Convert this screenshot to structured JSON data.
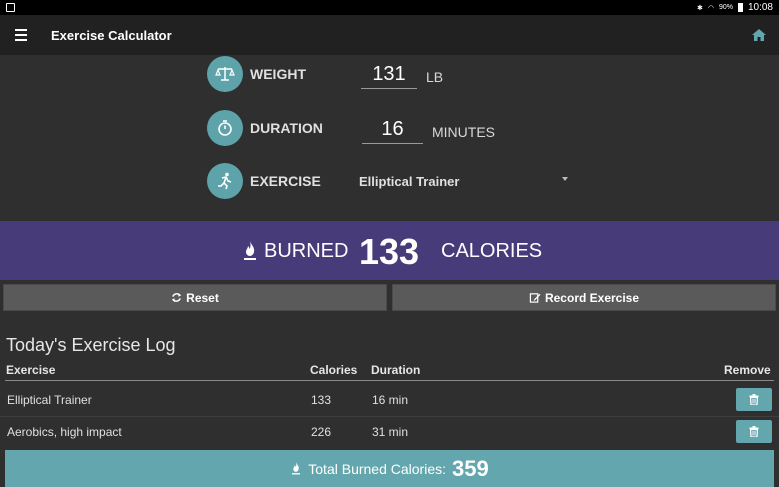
{
  "status_bar": {
    "battery": "90%",
    "time": "10:08"
  },
  "app_bar": {
    "title": "Exercise Calculator"
  },
  "form": {
    "weight": {
      "label": "WEIGHT",
      "value": "131",
      "unit": "LB"
    },
    "duration": {
      "label": "DURATION",
      "value": "16",
      "unit": "MINUTES"
    },
    "exercise": {
      "label": "EXERCISE",
      "selected": "Elliptical Trainer"
    }
  },
  "burned": {
    "prefix": "BURNED",
    "value": "133",
    "suffix": "CALORIES"
  },
  "buttons": {
    "reset": "Reset",
    "record": "Record Exercise"
  },
  "log": {
    "title": "Today's Exercise Log",
    "headers": {
      "exercise": "Exercise",
      "calories": "Calories",
      "duration": "Duration",
      "remove": "Remove"
    },
    "rows": [
      {
        "exercise": "Elliptical Trainer",
        "calories": "133",
        "duration": "16 min"
      },
      {
        "exercise": "Aerobics, high impact",
        "calories": "226",
        "duration": "31 min"
      }
    ]
  },
  "total": {
    "label": "Total Burned Calories:",
    "value": "359"
  },
  "colors": {
    "accent": "#63a6ad",
    "burned_band": "#473b7a",
    "app_bar": "#212121",
    "background": "#2f2f2f"
  }
}
